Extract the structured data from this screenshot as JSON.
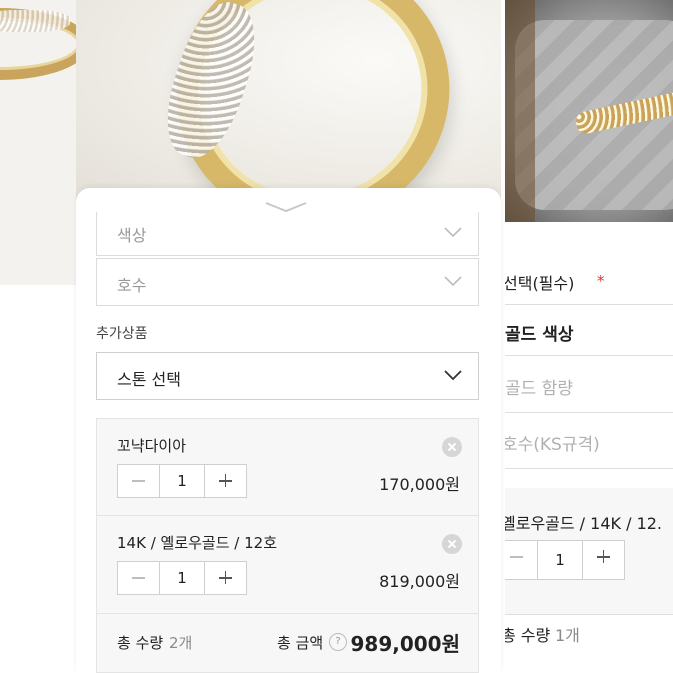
{
  "left_panel": {
    "select_color": "색상",
    "select_size": "호수",
    "addon_heading": "추가상품",
    "stone_select": "스톤 선택",
    "items": [
      {
        "name": "꼬냑다이아",
        "qty": "1",
        "price": "170,000원"
      },
      {
        "name": "14K / 옐로우골드 / 12호",
        "qty": "1",
        "price": "819,000원"
      }
    ],
    "total_qty_label": "총 수량",
    "total_qty_value": "2개",
    "total_amount_label": "총 금액",
    "total_help": "?",
    "total_amount": "989,000원"
  },
  "right_panel": {
    "option_title": "선택(필수)",
    "required_mark": "*",
    "gold_color": "골드 색상",
    "gold_purity": "골드 함량",
    "size_ks": "호수(KS규격)",
    "item_name": "옐로우골드 / 14K / 12.",
    "qty": "1",
    "total_qty_label": "총 수량",
    "total_qty_value": "1개"
  },
  "colors": {
    "accent": "#8a8a8a",
    "required": "#e0342a",
    "panel_bg": "#f7f7f7"
  }
}
